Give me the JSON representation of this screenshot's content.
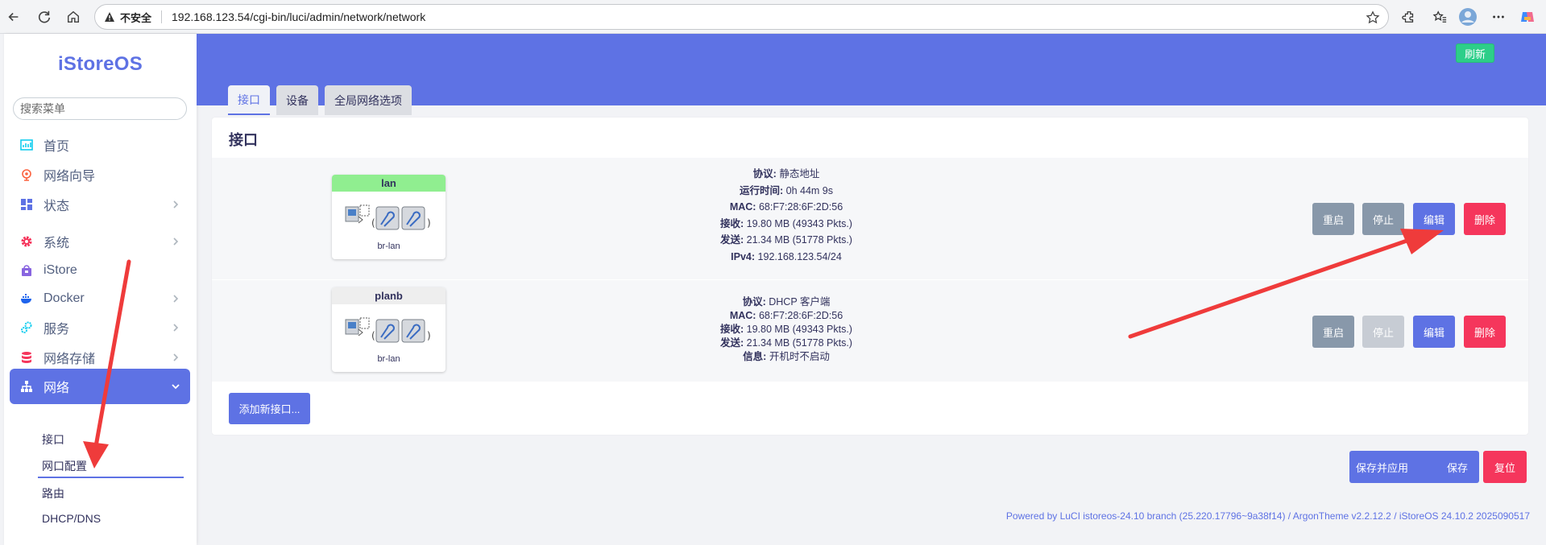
{
  "browser": {
    "insecure_label": "不安全",
    "url": "192.168.123.54/cgi-bin/luci/admin/network/network"
  },
  "sidebar": {
    "logo": "iStoreOS",
    "search_placeholder": "搜索菜单",
    "items": [
      {
        "label": "首页",
        "icon": "dashboard-icon"
      },
      {
        "label": "网络向导",
        "icon": "globe-icon"
      },
      {
        "label": "状态",
        "icon": "grid-icon"
      },
      {
        "label": "系统",
        "icon": "gear-icon"
      },
      {
        "label": "iStore",
        "icon": "store-icon"
      },
      {
        "label": "Docker",
        "icon": "docker-icon"
      },
      {
        "label": "服务",
        "icon": "services-icon"
      },
      {
        "label": "网络存储",
        "icon": "database-icon"
      },
      {
        "label": "网络",
        "icon": "network-icon"
      }
    ],
    "sub_items": [
      "接口",
      "网口配置",
      "路由",
      "DHCP/DNS"
    ]
  },
  "header": {
    "refresh_label": "刷新"
  },
  "tabs": [
    "接口",
    "设备",
    "全局网络选项"
  ],
  "section_title": "接口",
  "interfaces": [
    {
      "name": "lan",
      "device": "br-lan",
      "head_color": "#90ee90",
      "info": [
        {
          "label": "协议:",
          "value": "静态地址"
        },
        {
          "label": "运行时间:",
          "value": "0h 44m 9s"
        },
        {
          "label": "MAC:",
          "value": "68:F7:28:6F:2D:56"
        },
        {
          "label": "接收:",
          "value": "19.80 MB (49343 Pkts.)"
        },
        {
          "label": "发送:",
          "value": "21.34 MB (51778 Pkts.)"
        },
        {
          "label": "IPv4:",
          "value": "192.168.123.54/24"
        }
      ]
    },
    {
      "name": "planb",
      "device": "br-lan",
      "head_color": "#eeeeee",
      "info": [
        {
          "label": "协议:",
          "value": "DHCP 客户端"
        },
        {
          "label": "MAC:",
          "value": "68:F7:28:6F:2D:56"
        },
        {
          "label": "接收:",
          "value": "19.80 MB (49343 Pkts.)"
        },
        {
          "label": "发送:",
          "value": "21.34 MB (51778 Pkts.)"
        },
        {
          "label": "信息:",
          "value": "开机时不启动"
        }
      ]
    }
  ],
  "row_buttons": {
    "restart": "重启",
    "stop": "停止",
    "edit": "编辑",
    "delete": "删除"
  },
  "add_interface_label": "添加新接口...",
  "bottom_buttons": {
    "save_apply": "保存并应用",
    "save": "保存",
    "reset": "复位"
  },
  "footer": "Powered by LuCI istoreos-24.10 branch (25.220.17796~9a38f14) / ArgonTheme v2.2.12.2 / iStoreOS 24.10.2 2025090517",
  "colors": {
    "primary": "#5e72e4",
    "success": "#2dce89",
    "danger": "#f5365c",
    "gray": "#8898aa",
    "annotation_arrow": "#ef3b3b"
  }
}
